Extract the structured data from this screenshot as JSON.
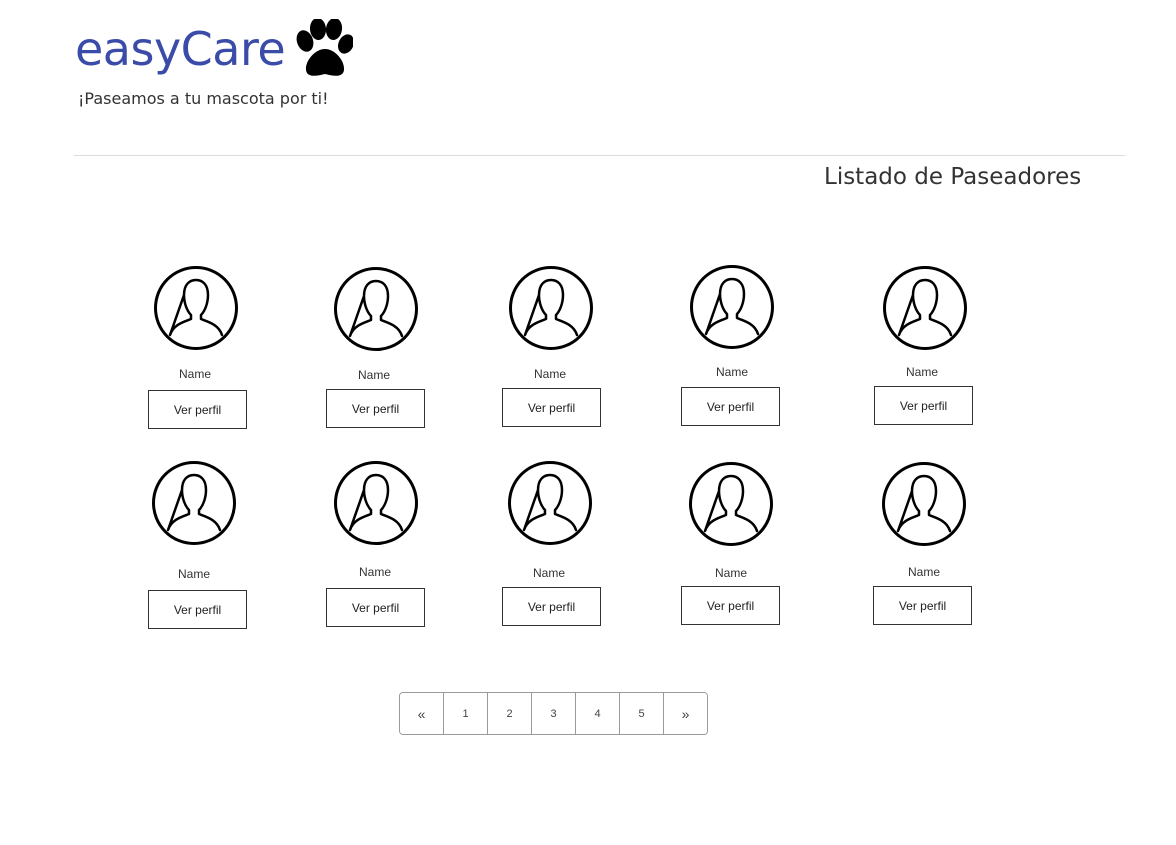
{
  "brand": {
    "name": "easyCare",
    "logo_icon": "paw-icon",
    "color": "#3b4ba8"
  },
  "tagline": "¡Paseamos a tu mascota por ti!",
  "page_title": "Listado de Paseadores",
  "walkers": [
    {
      "name": "Name",
      "button": "Ver perfil",
      "avatar_icon": "user-avatar-icon"
    },
    {
      "name": "Name",
      "button": "Ver perfil",
      "avatar_icon": "user-avatar-icon"
    },
    {
      "name": "Name",
      "button": "Ver perfil",
      "avatar_icon": "user-avatar-icon"
    },
    {
      "name": "Name",
      "button": "Ver perfil",
      "avatar_icon": "user-avatar-icon"
    },
    {
      "name": "Name",
      "button": "Ver perfil",
      "avatar_icon": "user-avatar-icon"
    },
    {
      "name": "Name",
      "button": "Ver perfil",
      "avatar_icon": "user-avatar-icon"
    },
    {
      "name": "Name",
      "button": "Ver perfil",
      "avatar_icon": "user-avatar-icon"
    },
    {
      "name": "Name",
      "button": "Ver perfil",
      "avatar_icon": "user-avatar-icon"
    },
    {
      "name": "Name",
      "button": "Ver perfil",
      "avatar_icon": "user-avatar-icon"
    },
    {
      "name": "Name",
      "button": "Ver perfil",
      "avatar_icon": "user-avatar-icon"
    }
  ],
  "pagination": {
    "prev": "«",
    "pages": [
      "1",
      "2",
      "3",
      "4",
      "5"
    ],
    "next": "»"
  }
}
